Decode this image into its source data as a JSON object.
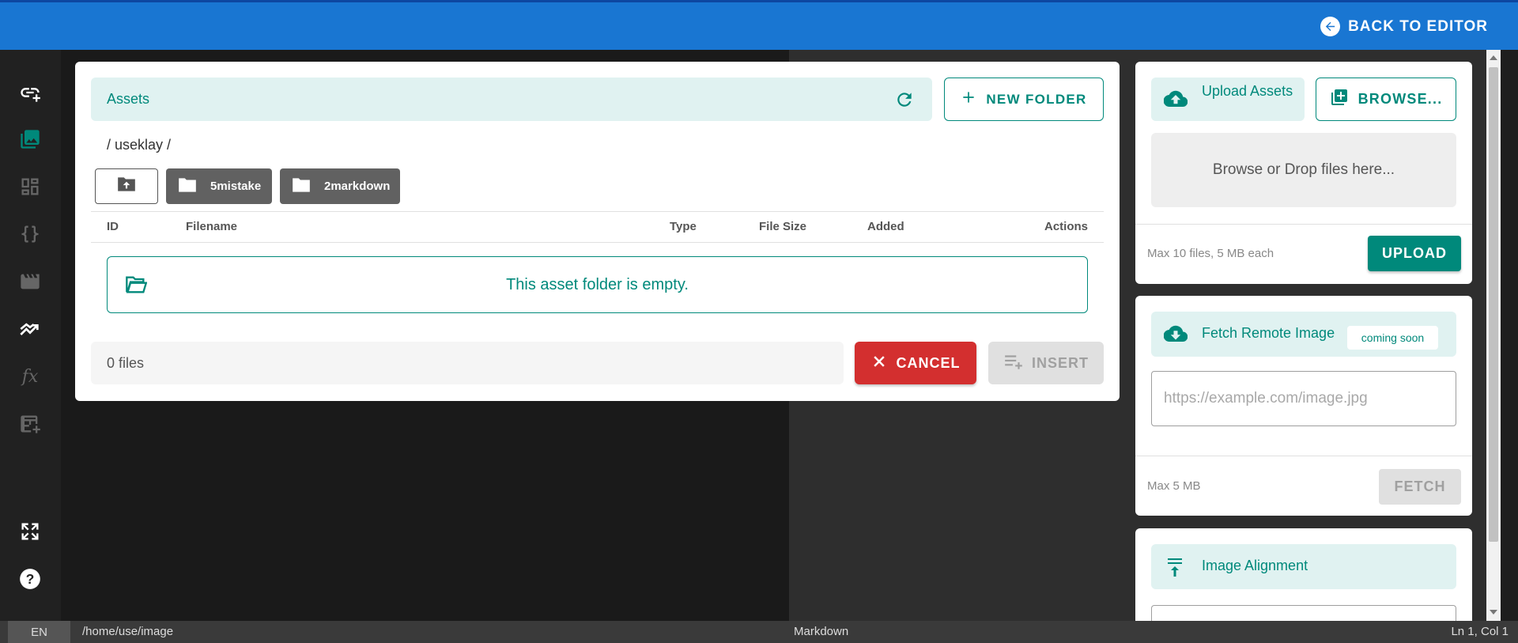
{
  "topbar": {
    "back_label": "BACK TO EDITOR"
  },
  "nav": [
    "link-plus-icon",
    "images-icon",
    "dashboard-icon",
    "braces-icon",
    "clapperboard-icon",
    "chart-icon",
    "function-icon",
    "table-add-icon",
    "fullscreen-icon",
    "help-icon"
  ],
  "assets": {
    "title": "Assets",
    "new_folder_label": "NEW FOLDER",
    "path": "/ useklay /",
    "folders": [
      "5mistake",
      "2markdown"
    ],
    "columns": {
      "id": "ID",
      "filename": "Filename",
      "type": "Type",
      "size": "File Size",
      "added": "Added",
      "actions": "Actions"
    },
    "empty_message": "This asset folder is empty.",
    "file_count": "0 files",
    "cancel_label": "CANCEL",
    "insert_label": "INSERT"
  },
  "upload": {
    "title": "Upload Assets",
    "browse_label": "BROWSE...",
    "drop_text": "Browse or Drop files here...",
    "limits": "Max 10 files, 5 MB each",
    "upload_label": "UPLOAD"
  },
  "fetch": {
    "title": "Fetch Remote Image",
    "badge": "coming soon",
    "placeholder": "https://example.com/image.jpg",
    "limit": "Max 5 MB",
    "fetch_label": "FETCH"
  },
  "alignment": {
    "title": "Image Alignment"
  },
  "status": {
    "lang": "EN",
    "path": "/home/use/image",
    "mode": "Markdown",
    "position": "Ln 1, Col 1"
  },
  "colors": {
    "primary": "#1976d2",
    "teal": "#00897b",
    "danger": "#d32f2f"
  }
}
